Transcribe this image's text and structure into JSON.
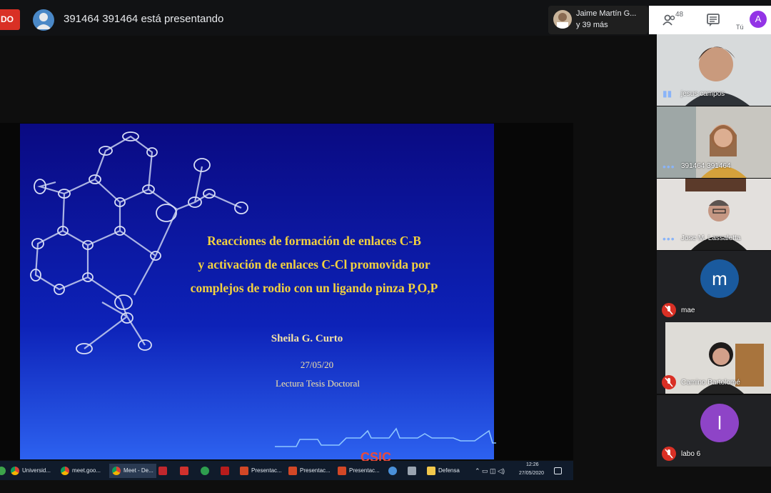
{
  "top_bar": {
    "recording_label": "DO",
    "presenting_text": "391464 391464 está presentando",
    "people_preview_name": "Jaime Martín G...",
    "people_preview_more": "y 39 más",
    "participant_count": "48",
    "you_initial": "A",
    "you_label": "Tú"
  },
  "slide": {
    "title_lines": [
      "Reacciones de formación de enlaces C-B",
      "y activación de enlaces C-Cl promovida por",
      "complejos de rodio con un ligando pinza P,O,P"
    ],
    "author": "Sheila G. Curto",
    "date": "27/05/20",
    "description": "Lectura Tesis Doctoral",
    "logo_text": "CSIC"
  },
  "taskbar": {
    "items": [
      {
        "label": "Universid...",
        "icon": "chrome-icon"
      },
      {
        "label": "meet.goo...",
        "icon": "chrome-icon"
      },
      {
        "label": "Meet - De...",
        "icon": "chrome-icon"
      },
      {
        "label": "",
        "icon": "filezilla-icon"
      },
      {
        "label": "",
        "icon": "wps-icon"
      },
      {
        "label": "",
        "icon": "app-icon"
      },
      {
        "label": "",
        "icon": "pdf-icon"
      },
      {
        "label": "Presentac...",
        "icon": "powerpoint-icon"
      },
      {
        "label": "Presentac...",
        "icon": "powerpoint-icon"
      },
      {
        "label": "Presentac...",
        "icon": "powerpoint-icon"
      },
      {
        "label": "",
        "icon": "app-icon"
      },
      {
        "label": "",
        "icon": "printer-icon"
      },
      {
        "label": "Defensa",
        "icon": "folder-icon"
      }
    ],
    "time": "12:26",
    "date": "27/05/2020"
  },
  "participants": [
    {
      "name": "jesus campos",
      "type": "video"
    },
    {
      "name": "391464 391464",
      "type": "video"
    },
    {
      "name": "Jose M. Lassaletta",
      "type": "video"
    },
    {
      "name": "mae",
      "initial": "m",
      "type": "avatar",
      "color": "#1a5a9e"
    },
    {
      "name": "Camino Bartolomé",
      "type": "video"
    },
    {
      "name": "labo 6",
      "initial": "l",
      "type": "avatar",
      "color": "#8e44c7"
    }
  ],
  "colors": {
    "recording": "#d93025",
    "slide_title": "#f2d13f",
    "you_avatar": "#9334e6"
  }
}
